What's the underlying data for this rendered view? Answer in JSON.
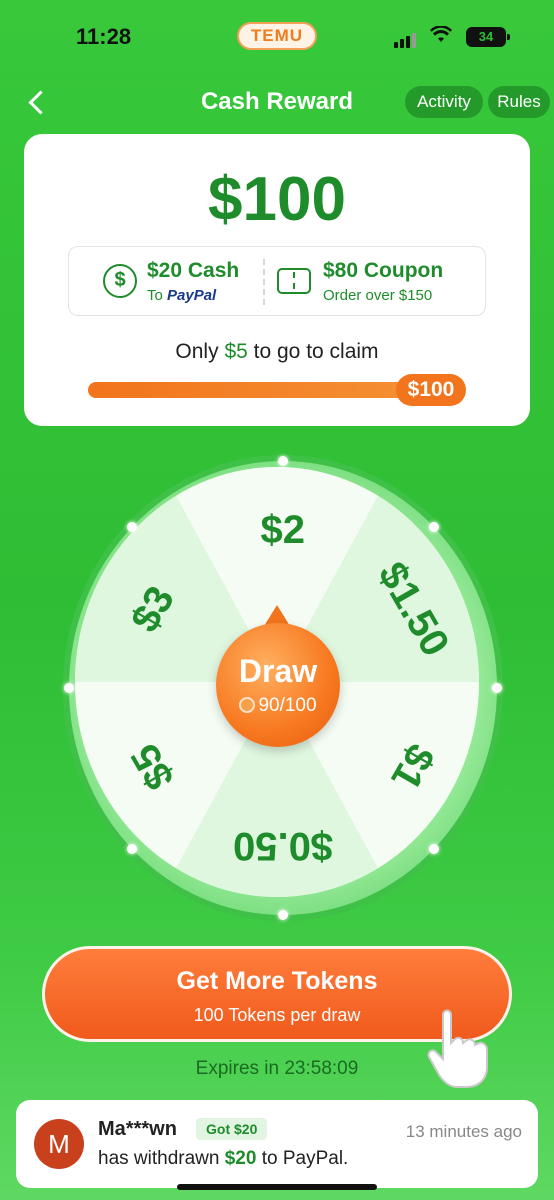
{
  "status_bar": {
    "time": "11:28",
    "app_badge": "TEMU",
    "battery": "34"
  },
  "header": {
    "title": "Cash Reward",
    "activity_label": "Activity",
    "rules_label": "Rules"
  },
  "reward": {
    "amount": "$100",
    "cash": {
      "title": "$20 Cash",
      "sub_prefix": "To",
      "sub_brand": "PayPal"
    },
    "coupon": {
      "title": "$80 Coupon",
      "sub": "Order over $150"
    },
    "claim_prefix": "Only",
    "claim_amount": "$5",
    "claim_suffix": "to go to claim",
    "progress_fraction": 0.95,
    "progress_cap": "$100"
  },
  "wheel": {
    "segments": [
      "$2",
      "$1.50",
      "$1",
      "$0.50",
      "$5",
      "$3"
    ],
    "draw_label": "Draw",
    "draw_count": "90/100",
    "segment_colors": [
      "#f4fcf4",
      "#dff6df"
    ]
  },
  "cta": {
    "title": "Get More Tokens",
    "subtitle": "100 Tokens per draw"
  },
  "expires": "Expires in 23:58:09",
  "notification": {
    "avatar_letter": "M",
    "user": "Ma***wn",
    "badge": "Got $20",
    "time": "13 minutes ago",
    "msg_prefix": "has withdrawn",
    "msg_amount": "$20",
    "msg_suffix": "to PayPal."
  },
  "colors": {
    "brand_green": "#1f8c2b",
    "accent_orange": "#f2741c",
    "bg_green": "#38c83a"
  }
}
